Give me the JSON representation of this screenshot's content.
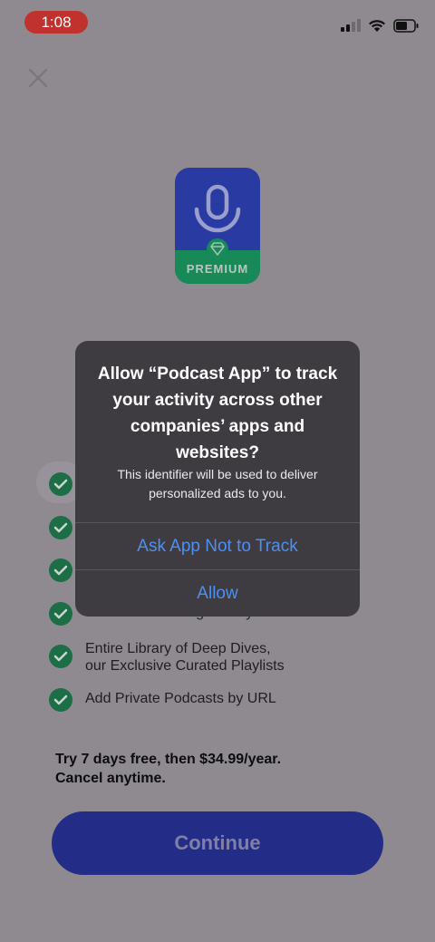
{
  "status_bar": {
    "time": "1:08",
    "icons": [
      "signal-icon",
      "wifi-icon",
      "battery-icon"
    ]
  },
  "close_icon": "close-icon",
  "premium_badge": {
    "label": "PREMIUM",
    "icons": [
      "microphone-icon",
      "diamond-icon"
    ],
    "colors": {
      "top": "#2a3aa3",
      "band": "#178a58"
    }
  },
  "features": [
    {
      "text": ""
    },
    {
      "text": ""
    },
    {
      "text": ""
    },
    {
      "text": "Your Full Listening History"
    },
    {
      "text": "Entire Library of Deep Dives,\nour Exclusive Curated Playlists"
    },
    {
      "text": "Add Private Podcasts by URL"
    }
  ],
  "pricing": {
    "line1": "Try 7 days free, then $34.99/year.",
    "line2": "Cancel anytime."
  },
  "continue_label": "Continue",
  "alert": {
    "title": "Allow “Podcast App” to track your activity across other companies’ apps and websites?",
    "message": "This identifier will be used to deliver personalized ads to you.",
    "buttons": {
      "ask_not_to_track": "Ask App Not to Track",
      "allow": "Allow"
    },
    "button_color": "#4d8ff2"
  }
}
